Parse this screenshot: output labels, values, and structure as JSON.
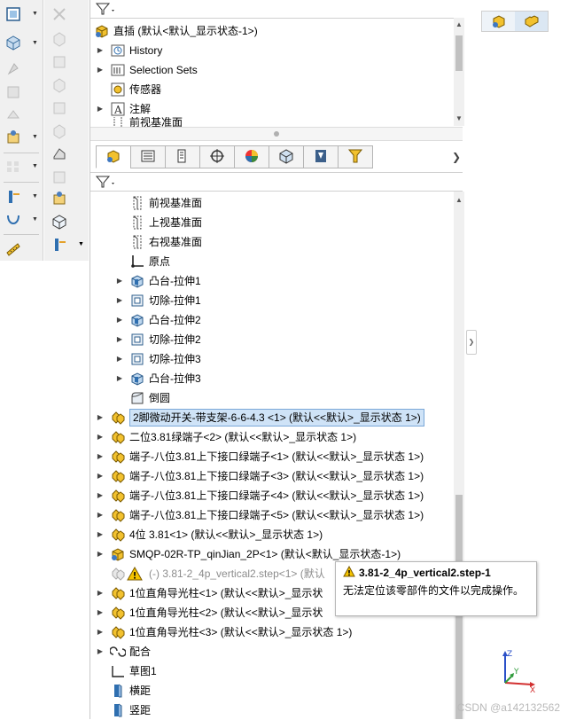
{
  "feature_tree_top": {
    "root": "直插 (默认<默认_显示状态-1>)",
    "items": [
      {
        "label": "History",
        "icon": "history-icon"
      },
      {
        "label": "Selection Sets",
        "icon": "selection-sets-icon"
      },
      {
        "label": "传感器",
        "icon": "sensor-icon"
      },
      {
        "label": "注解",
        "icon": "annotation-icon"
      },
      {
        "label": "前视基准面",
        "icon": "plane-icon"
      }
    ]
  },
  "tree": {
    "items": [
      {
        "label": "前视基准面",
        "icon": "plane-icon",
        "indent": 2,
        "expand": false
      },
      {
        "label": "上视基准面",
        "icon": "plane-icon",
        "indent": 2,
        "expand": false
      },
      {
        "label": "右视基准面",
        "icon": "plane-icon",
        "indent": 2,
        "expand": false
      },
      {
        "label": "原点",
        "icon": "origin-icon",
        "indent": 2,
        "expand": false
      },
      {
        "label": "凸台-拉伸1",
        "icon": "extrude-icon",
        "indent": 2,
        "expand": true
      },
      {
        "label": "切除-拉伸1",
        "icon": "cut-icon",
        "indent": 2,
        "expand": true
      },
      {
        "label": "凸台-拉伸2",
        "icon": "extrude-icon",
        "indent": 2,
        "expand": true
      },
      {
        "label": "切除-拉伸2",
        "icon": "cut-icon",
        "indent": 2,
        "expand": true
      },
      {
        "label": "切除-拉伸3",
        "icon": "cut-icon",
        "indent": 2,
        "expand": true
      },
      {
        "label": "凸台-拉伸3",
        "icon": "extrude-icon",
        "indent": 2,
        "expand": true
      },
      {
        "label": "倒圆",
        "icon": "fillet-icon",
        "indent": 2,
        "expand": false
      },
      {
        "label": "2脚微动开关-带支架-6-6-4.3 <1> (默认<<默认>_显示状态 1>)",
        "icon": "part-icon",
        "indent": 0,
        "expand": true,
        "selected": true
      },
      {
        "label": "二位3.81绿端子<2> (默认<<默认>_显示状态 1>)",
        "icon": "part-icon",
        "indent": 0,
        "expand": true
      },
      {
        "label": "端子-八位3.81上下接口绿端子<1> (默认<<默认>_显示状态 1>)",
        "icon": "part-icon",
        "indent": 0,
        "expand": true
      },
      {
        "label": "端子-八位3.81上下接口绿端子<3> (默认<<默认>_显示状态 1>)",
        "icon": "part-icon",
        "indent": 0,
        "expand": true
      },
      {
        "label": "端子-八位3.81上下接口绿端子<4> (默认<<默认>_显示状态 1>)",
        "icon": "part-icon",
        "indent": 0,
        "expand": true
      },
      {
        "label": "端子-八位3.81上下接口绿端子<5> (默认<<默认>_显示状态 1>)",
        "icon": "part-icon",
        "indent": 0,
        "expand": true
      },
      {
        "label": "4位 3.81<1> (默认<<默认>_显示状态 1>)",
        "icon": "part-icon",
        "indent": 0,
        "expand": true
      },
      {
        "label": "SMQP-02R-TP_qinJian_2P<1> (默认<默认_显示状态-1>)",
        "icon": "assembly-icon",
        "indent": 0,
        "expand": true
      },
      {
        "label": "(-) 3.81-2_4p_vertical2.step<1> (默认",
        "icon": "warning-part-icon",
        "indent": 0,
        "expand": false,
        "grey": true
      },
      {
        "label": "1位直角导光柱<1> (默认<<默认>_显示状",
        "icon": "part-icon",
        "indent": 0,
        "expand": true
      },
      {
        "label": "1位直角导光柱<2> (默认<<默认>_显示状",
        "icon": "part-icon",
        "indent": 0,
        "expand": true
      },
      {
        "label": "1位直角导光柱<3> (默认<<默认>_显示状态 1>)",
        "icon": "part-icon",
        "indent": 0,
        "expand": true
      },
      {
        "label": "配合",
        "icon": "mate-icon",
        "indent": 0,
        "expand": true
      },
      {
        "label": "草图1",
        "icon": "sketch-icon",
        "indent": 0,
        "expand": false
      },
      {
        "label": "横距",
        "icon": "pattern-icon",
        "indent": 0,
        "expand": false
      },
      {
        "label": "竖距",
        "icon": "pattern-icon",
        "indent": 0,
        "expand": false
      }
    ]
  },
  "tabs": [
    {
      "name": "featuremanager-tab",
      "icon": "feature-tree-icon"
    },
    {
      "name": "propertymanager-tab",
      "icon": "property-icon"
    },
    {
      "name": "configurationmanager-tab",
      "icon": "configuration-icon"
    },
    {
      "name": "dimxpert-tab",
      "icon": "crosshair-icon"
    },
    {
      "name": "display-manager-tab",
      "icon": "appearance-icon"
    },
    {
      "name": "cam-tab",
      "icon": "cam-cube-icon"
    },
    {
      "name": "simulation-tab",
      "icon": "simulation-icon"
    },
    {
      "name": "flow-tab",
      "icon": "funnel-tool-icon"
    }
  ],
  "tooltip": {
    "title": "3.81-2_4p_vertical2.step-1",
    "body": "无法定位该零部件的文件以完成操作。"
  },
  "watermark": "CSDN @a142132562",
  "triad": {
    "x": "X",
    "y": "Y",
    "z": "Z"
  },
  "colors": {
    "selection": "#cfe3f7",
    "part_yellow": "#f2c12e",
    "toolbar": "#f0f0f0"
  }
}
